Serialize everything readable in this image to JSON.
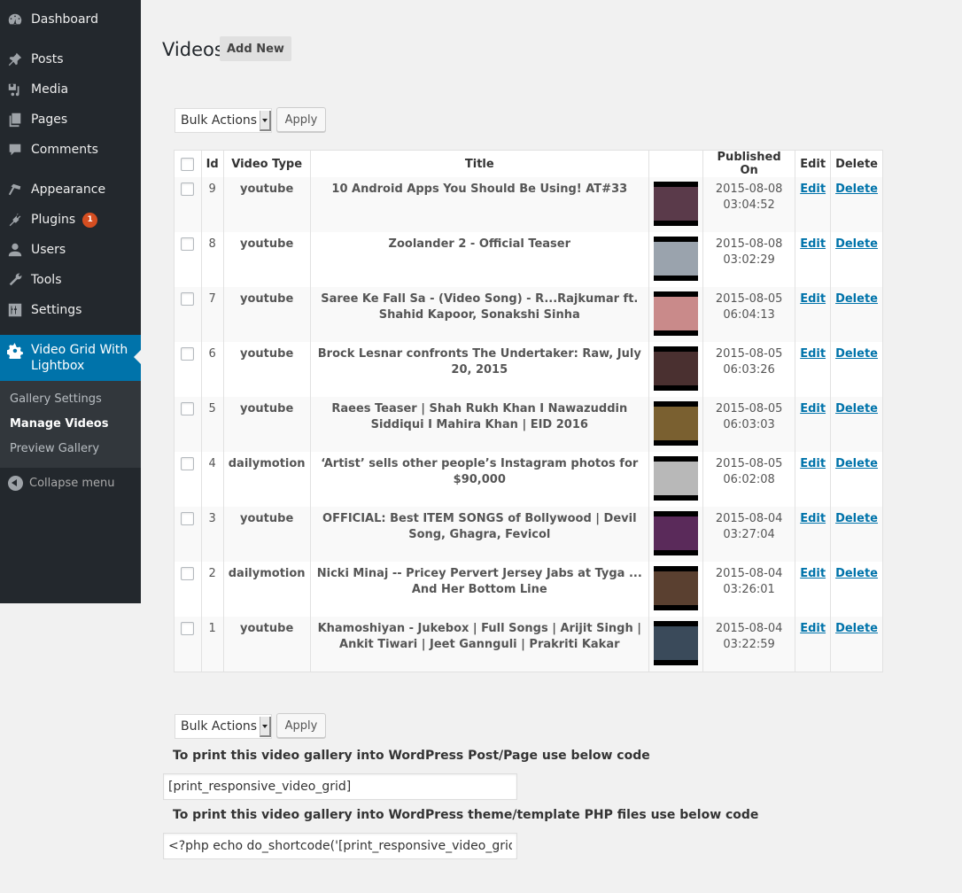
{
  "sidebar": {
    "items": [
      {
        "label": "Dashboard",
        "icon": "dashboard-icon"
      },
      {
        "label": "Posts",
        "icon": "pin-icon"
      },
      {
        "label": "Media",
        "icon": "media-icon"
      },
      {
        "label": "Pages",
        "icon": "pages-icon"
      },
      {
        "label": "Comments",
        "icon": "comment-icon"
      },
      {
        "label": "Appearance",
        "icon": "paintbrush-icon"
      },
      {
        "label": "Plugins",
        "icon": "plugin-icon",
        "badge": "1"
      },
      {
        "label": "Users",
        "icon": "user-icon"
      },
      {
        "label": "Tools",
        "icon": "wrench-icon"
      },
      {
        "label": "Settings",
        "icon": "settings-icon"
      }
    ],
    "current": {
      "label": "Video Grid With Lightbox",
      "icon": "gear-icon"
    },
    "submenu": [
      {
        "label": "Gallery Settings"
      },
      {
        "label": "Manage Videos",
        "current": true
      },
      {
        "label": "Preview Gallery"
      }
    ],
    "collapse_label": "Collapse menu"
  },
  "header": {
    "title": "Videos",
    "add_new_label": "Add New"
  },
  "bulk": {
    "selected": "Bulk Actions",
    "apply_label": "Apply"
  },
  "table": {
    "columns": [
      "",
      "Id",
      "Video Type",
      "Title",
      "",
      "Published On",
      "Edit",
      "Delete"
    ],
    "rows": [
      {
        "id": "9",
        "type": "youtube",
        "title": "10 Android Apps You Should Be Using! AT#33",
        "date": "2015-08-08",
        "time": "03:04:52",
        "edit": "Edit",
        "delete": "Delete",
        "thumb_color": "#5a3a4a"
      },
      {
        "id": "8",
        "type": "youtube",
        "title": "Zoolander 2 - Official Teaser",
        "date": "2015-08-08",
        "time": "03:02:29",
        "edit": "Edit",
        "delete": "Delete",
        "thumb_color": "#9aa3ad"
      },
      {
        "id": "7",
        "type": "youtube",
        "title": "Saree Ke Fall Sa - (Video Song) - R...Rajkumar ft. Shahid Kapoor, Sonakshi Sinha",
        "date": "2015-08-05",
        "time": "06:04:13",
        "edit": "Edit",
        "delete": "Delete",
        "thumb_color": "#c98a8a"
      },
      {
        "id": "6",
        "type": "youtube",
        "title": "Brock Lesnar confronts The Undertaker: Raw, July 20, 2015",
        "date": "2015-08-05",
        "time": "06:03:26",
        "edit": "Edit",
        "delete": "Delete",
        "thumb_color": "#4a3030"
      },
      {
        "id": "5",
        "type": "youtube",
        "title": "Raees Teaser | Shah Rukh Khan I Nawazuddin Siddiqui I Mahira Khan | EID 2016",
        "date": "2015-08-05",
        "time": "06:03:03",
        "edit": "Edit",
        "delete": "Delete",
        "thumb_color": "#7a6030"
      },
      {
        "id": "4",
        "type": "dailymotion",
        "title": "‘Artist’ sells other people’s Instagram photos for $90,000",
        "date": "2015-08-05",
        "time": "06:02:08",
        "edit": "Edit",
        "delete": "Delete",
        "thumb_color": "#b8b8b8"
      },
      {
        "id": "3",
        "type": "youtube",
        "title": "OFFICIAL: Best ITEM SONGS of Bollywood | Devil Song, Ghagra, Fevicol",
        "date": "2015-08-04",
        "time": "03:27:04",
        "edit": "Edit",
        "delete": "Delete",
        "thumb_color": "#5a2a5a"
      },
      {
        "id": "2",
        "type": "dailymotion",
        "title": "Nicki Minaj -- Pricey Pervert Jersey Jabs at Tyga ... And Her Bottom Line",
        "date": "2015-08-04",
        "time": "03:26:01",
        "edit": "Edit",
        "delete": "Delete",
        "thumb_color": "#5a4030"
      },
      {
        "id": "1",
        "type": "youtube",
        "title": "Khamoshiyan - Jukebox | Full Songs | Arijit Singh | Ankit Tiwari | Jeet Gannguli | Prakriti Kakar",
        "date": "2015-08-04",
        "time": "03:22:59",
        "edit": "Edit",
        "delete": "Delete",
        "thumb_color": "#3a4a5a"
      }
    ]
  },
  "shortcode": {
    "post_label": "To print this video gallery into WordPress Post/Page use below code",
    "post_value": "[print_responsive_video_grid]",
    "php_label": "To print this video gallery into WordPress theme/template PHP files use below code",
    "php_value": "<?php echo do_shortcode('[print_responsive_video_grid]'); ?>"
  },
  "colors": {
    "sidebar_bg": "#23282d",
    "accent": "#0073aa",
    "badge": "#d54e21",
    "link": "#0073aa"
  }
}
